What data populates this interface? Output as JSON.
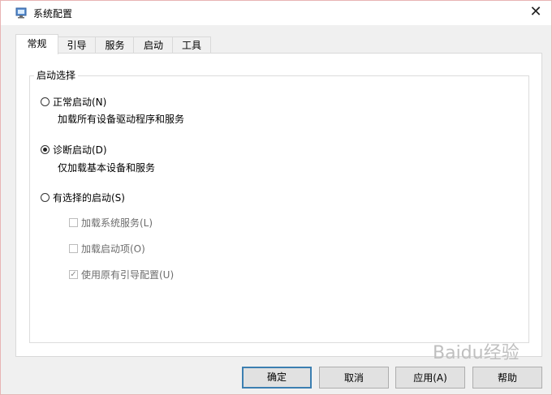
{
  "window": {
    "title": "系统配置"
  },
  "tabs": [
    {
      "label": "常规"
    },
    {
      "label": "引导"
    },
    {
      "label": "服务"
    },
    {
      "label": "启动"
    },
    {
      "label": "工具"
    }
  ],
  "startup": {
    "group_title": "启动选择",
    "normal": {
      "label": "正常启动(N)",
      "desc": "加载所有设备驱动程序和服务",
      "checked": false
    },
    "diagnostic": {
      "label": "诊断启动(D)",
      "desc": "仅加载基本设备和服务",
      "checked": true
    },
    "selective": {
      "label": "有选择的启动(S)",
      "checked": false,
      "options": [
        {
          "label": "加载系统服务(L)",
          "checked": false
        },
        {
          "label": "加载启动项(O)",
          "checked": false
        },
        {
          "label": "使用原有引导配置(U)",
          "checked": true
        }
      ]
    }
  },
  "buttons": {
    "ok": "确定",
    "cancel": "取消",
    "apply": "应用(A)",
    "help": "帮助"
  },
  "watermark": {
    "text": "Baidu经验"
  }
}
